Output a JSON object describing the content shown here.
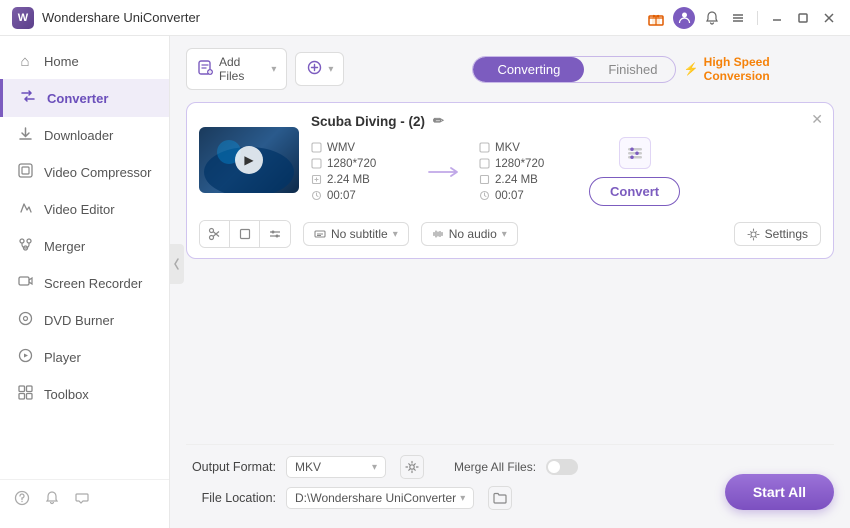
{
  "app": {
    "title": "Wondershare UniConverter",
    "logo_text": "W"
  },
  "titlebar": {
    "actions": [
      "gift-icon",
      "user-icon",
      "bell-icon",
      "menu-icon",
      "minimize-icon",
      "maximize-icon",
      "close-icon"
    ]
  },
  "sidebar": {
    "items": [
      {
        "id": "home",
        "label": "Home",
        "icon": "⌂"
      },
      {
        "id": "converter",
        "label": "Converter",
        "icon": "⇌",
        "active": true
      },
      {
        "id": "downloader",
        "label": "Downloader",
        "icon": "↓"
      },
      {
        "id": "video-compressor",
        "label": "Video Compressor",
        "icon": "▣"
      },
      {
        "id": "video-editor",
        "label": "Video Editor",
        "icon": "✂"
      },
      {
        "id": "merger",
        "label": "Merger",
        "icon": "⊕"
      },
      {
        "id": "screen-recorder",
        "label": "Screen Recorder",
        "icon": "◉"
      },
      {
        "id": "dvd-burner",
        "label": "DVD Burner",
        "icon": "⊙"
      },
      {
        "id": "player",
        "label": "Player",
        "icon": "▶"
      },
      {
        "id": "toolbox",
        "label": "Toolbox",
        "icon": "⊞"
      }
    ],
    "bottom_icons": [
      "question-icon",
      "bell-icon",
      "refresh-icon"
    ]
  },
  "toolbar": {
    "add_files_label": "Add Files",
    "add_files_icon": "📄",
    "add_more_label": "",
    "add_more_icon": "➕"
  },
  "tabs": {
    "converting_label": "Converting",
    "finished_label": "Finished"
  },
  "high_speed": {
    "label": "High Speed Conversion",
    "bolt_icon": "⚡"
  },
  "video_card": {
    "title": "Scuba Diving - (2)",
    "edit_icon": "✏",
    "source": {
      "format": "WMV",
      "resolution": "1280*720",
      "size": "2.24 MB",
      "duration": "00:07"
    },
    "target": {
      "format": "MKV",
      "resolution": "1280*720",
      "size": "2.24 MB",
      "duration": "00:07"
    },
    "subtitle": "No subtitle",
    "audio": "No audio",
    "convert_btn": "Convert",
    "settings_btn": "Settings"
  },
  "bottom_bar": {
    "output_format_label": "Output Format:",
    "output_format_value": "MKV",
    "file_location_label": "File Location:",
    "file_location_value": "D:\\Wondershare UniConverter",
    "merge_files_label": "Merge All Files:",
    "start_all_label": "Start All"
  }
}
